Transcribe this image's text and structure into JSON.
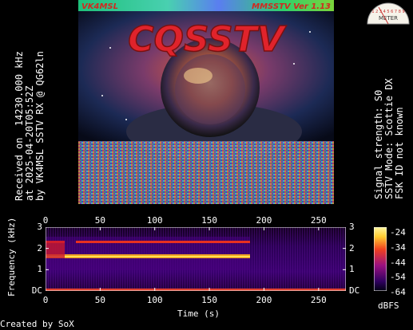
{
  "image": {
    "top_left_text": "VK4MSL",
    "top_right_text": "MMSSTV Ver 1.13",
    "headline": "CQSSTV"
  },
  "left_caption": {
    "line1": "Received on  14230.000 kHz",
    "line2": "at 2025-04-20T05:52Z",
    "line3": "by VK4MSL SSTV RX @ QG62ln"
  },
  "right_caption": {
    "line1": "Signal strength: S0",
    "line2": "SSTV Mode: Scottie DX",
    "line3": "FSK ID not known"
  },
  "meter_icon": {
    "name": "signal-meter-icon",
    "label": "METER",
    "scale": "1 2 3 4 5 6 7 8 9"
  },
  "spectrogram": {
    "x_ticks": [
      "0",
      "50",
      "100",
      "150",
      "200",
      "250"
    ],
    "x_values": [
      0,
      50,
      100,
      150,
      200,
      250
    ],
    "x_range": [
      0,
      275
    ],
    "y_ticks_left": [
      "3",
      "2",
      "1",
      "DC"
    ],
    "y_ticks_right": [
      "3",
      "2",
      "1",
      "DC"
    ],
    "y_values": [
      3,
      2,
      1,
      0
    ],
    "y_range": [
      0,
      3
    ],
    "ylabel": "Frequency (kHz)",
    "xlabel": "Time (s)",
    "colorbar_ticks": [
      "-24",
      "-34",
      "-44",
      "-54",
      "-64"
    ],
    "colorbar_unit": "dBFS"
  },
  "credit": "Created by SoX",
  "colors": {
    "headline_red": "#e0232b",
    "top_bar_green": "#2fd06b",
    "top_bar_blue": "#5a7ef0"
  }
}
